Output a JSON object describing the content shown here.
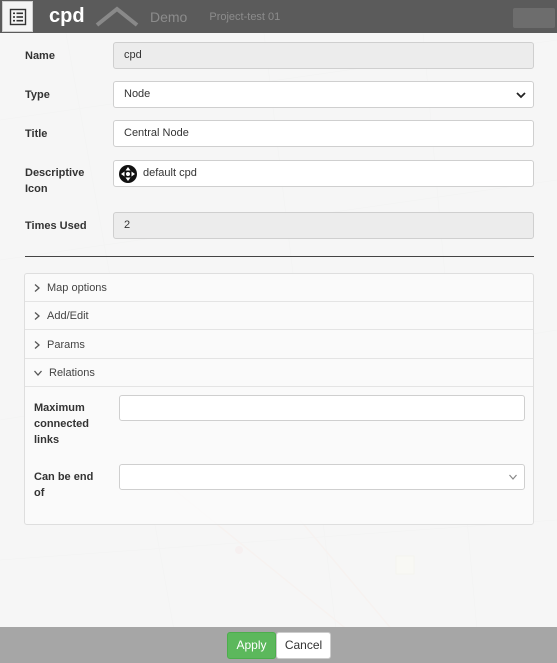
{
  "window": {
    "title": "cpd",
    "background_tabs": [
      "Demo",
      "Project-test 01"
    ]
  },
  "form": {
    "name": {
      "label": "Name",
      "value": "cpd"
    },
    "type": {
      "label": "Type",
      "value": "Node"
    },
    "title": {
      "label": "Title",
      "value": "Central Node"
    },
    "icon": {
      "label": "Descriptive Icon",
      "value": "default cpd"
    },
    "times_used": {
      "label": "Times Used",
      "value": "2"
    }
  },
  "accordion": {
    "sections": [
      {
        "label": "Map options",
        "expanded": false
      },
      {
        "label": "Add/Edit",
        "expanded": false
      },
      {
        "label": "Params",
        "expanded": false
      },
      {
        "label": "Relations",
        "expanded": true
      }
    ],
    "relations": {
      "max_links": {
        "label": "Maximum connected links",
        "value": ""
      },
      "can_be_end_of": {
        "label": "Can be end of",
        "value": ""
      }
    }
  },
  "footer": {
    "apply_label": "Apply",
    "cancel_label": "Cancel"
  },
  "colors": {
    "header": "#5b5b5b",
    "apply": "#5cb85c",
    "footer": "#a6a6a6"
  }
}
